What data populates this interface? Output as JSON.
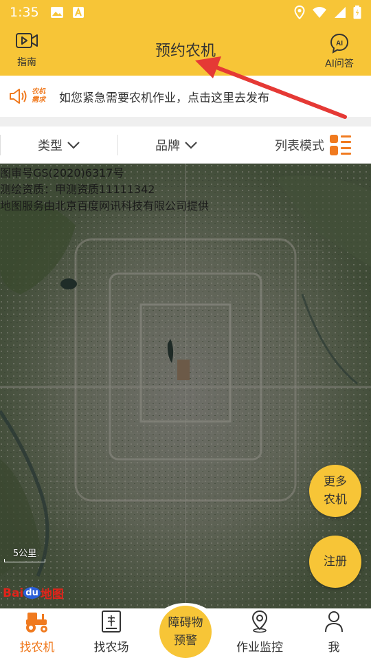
{
  "status_bar": {
    "time": "1:35"
  },
  "header": {
    "title": "预约农机",
    "guide_label": "指南",
    "ai_label": "AI问答"
  },
  "notice": {
    "tag_line1": "农机",
    "tag_line2": "需求",
    "text": "如您紧急需要农机作业，点击这里去发布"
  },
  "filters": {
    "type_label": "类型",
    "brand_label": "品牌",
    "list_mode_label": "列表模式"
  },
  "map": {
    "info_line1": "图审号GS(2020)6317号",
    "info_line2": "测绘资质：甲测资质11111342",
    "info_line3": "地图服务由北京百度网讯科技有限公司提供",
    "scale_label": "5公里",
    "logo_text_1": "Bai",
    "logo_text_2": "du",
    "logo_text_3": "地图",
    "more_machines": "更多农机",
    "register": "注册"
  },
  "bottom_nav": {
    "find_machine": "找农机",
    "find_farm": "找农场",
    "obstacle_alert": "障碍物预警",
    "work_monitor": "作业监控",
    "me": "我"
  },
  "colors": {
    "brand_yellow": "#f7c537",
    "accent_orange": "#f07a1f",
    "arrow_red": "#e53935"
  }
}
